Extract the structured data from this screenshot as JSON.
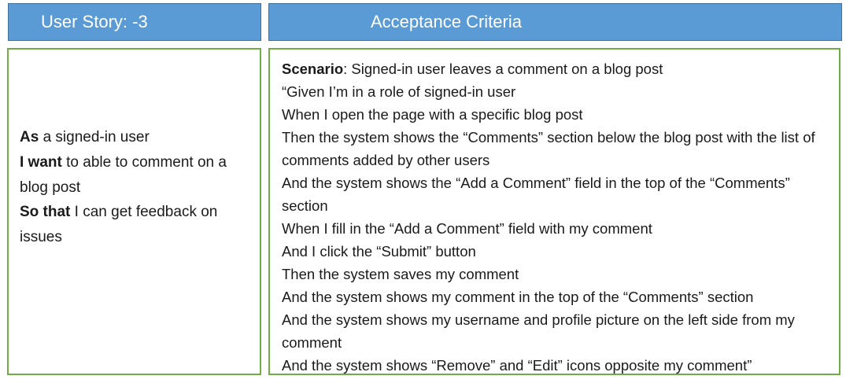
{
  "header": {
    "story_title": "User Story: -3",
    "criteria_title": "Acceptance Criteria"
  },
  "story": {
    "lines": [
      {
        "keyword": "As",
        "text": " a signed-in user"
      },
      {
        "keyword": "I want",
        "text": " to able to comment on a blog post"
      },
      {
        "keyword": "So that",
        "text": " I can get feedback on issues"
      }
    ]
  },
  "criteria": {
    "scenario_keyword": "Scenario",
    "scenario_text": ": Signed-in user leaves a comment on a blog post",
    "steps": [
      "“Given I’m in a role of signed-in user",
      "When I open the page with a specific blog post",
      "Then the system shows the “Comments” section below the blog post with the list of comments added by other users",
      "And the system shows the “Add a Comment” field in the top of the “Comments” section",
      "When I fill in the “Add a Comment” field with my comment",
      "And I click the “Submit” button",
      "Then the system saves my comment",
      "And the system shows my comment in the top of the “Comments” section",
      "And the system shows my username and profile picture on the left side from my comment",
      "And the system shows “Remove” and “Edit” icons opposite my comment”"
    ]
  }
}
